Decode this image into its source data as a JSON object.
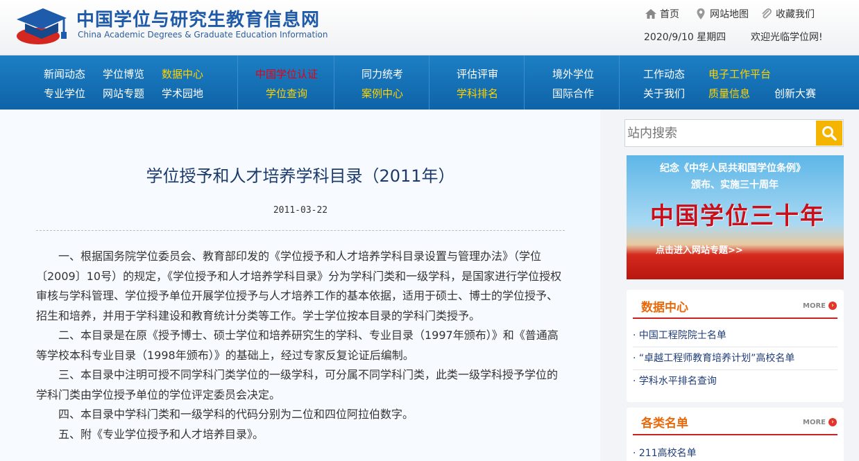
{
  "header": {
    "title_cn": "中国学位与研究生教育信息网",
    "title_en": "China Academic Degrees & Graduate Education Information",
    "links": {
      "home": "首页",
      "sitemap": "网站地图",
      "favorite": "收藏我们"
    },
    "date": "2020/9/10 星期四",
    "welcome": "欢迎光临学位网!"
  },
  "nav": {
    "col1": [
      "新闻动态",
      "学位博览",
      "数据中心",
      "专业学位",
      "网站专题",
      "学术园地"
    ],
    "col2": [
      "中国学位认证",
      "学位查询"
    ],
    "col3": [
      "同力统考",
      "案例中心"
    ],
    "col4": [
      "评估评审",
      "学科排名"
    ],
    "col5": [
      "境外学位",
      "国际合作"
    ],
    "col6": [
      "工作动态",
      "电子工作平台",
      "关于我们",
      "质量信息",
      "创新大赛"
    ]
  },
  "article": {
    "title": "学位授予和人才培养学科目录（2011年）",
    "date": "2011-03-22",
    "paragraphs": [
      "一、根据国务院学位委员会、教育部印发的《学位授予和人才培养学科目录设置与管理办法》（学位〔2009〕10号）的规定，《学位授予和人才培养学科目录》分为学科门类和一级学科，是国家进行学位授权审核与学科管理、学位授予单位开展学位授予与人才培养工作的基本依据，适用于硕士、博士的学位授予、招生和培养，并用于学科建设和教育统计分类等工作。学士学位按本目录的学科门类授予。",
      "二、本目录是在原《授予博士、硕士学位和培养研究生的学科、专业目录（1997年颁布）》和《普通高等学校本科专业目录（1998年颁布）》的基础上，经过专家反复论证后编制。",
      "三、本目录中注明可授不同学科门类学位的一级学科，可分属不同学科门类，此类一级学科授予学位的学科门类由学位授予单位的学位评定委员会决定。",
      "四、本目录中学科门类和一级学科的代码分别为二位和四位阿拉伯数字。",
      "五、附《专业学位授予和人才培养目录》。"
    ]
  },
  "sidebar": {
    "search_placeholder": "站内搜索",
    "banner": {
      "line1": "纪念《中华人民共和国学位条例》",
      "line2": "颁布、实施三十周年",
      "big": "中国学位三十年",
      "enter": "点击进入网站专题>>"
    },
    "data_center": {
      "title": "数据中心",
      "more": "MORE",
      "items": [
        "· 中国工程院院士名单",
        "· “卓越工程师教育培养计划”高校名单",
        "· 学科水平排名查询"
      ]
    },
    "lists": {
      "title": "各类名单",
      "more": "MORE",
      "items": [
        "· 211高校名单"
      ]
    }
  }
}
